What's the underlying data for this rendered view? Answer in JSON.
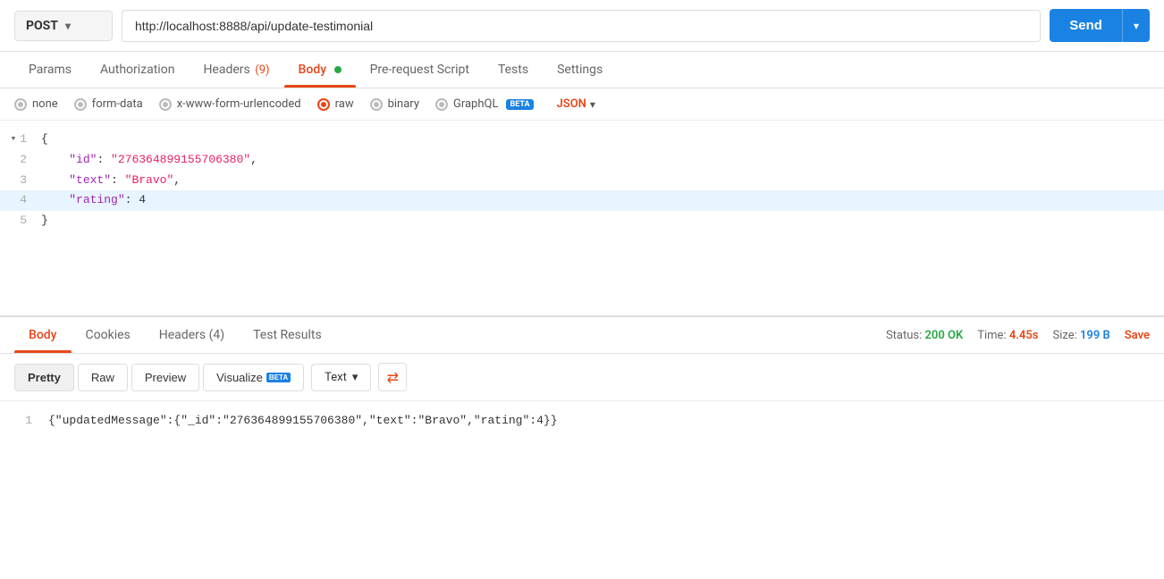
{
  "method": "POST",
  "url": "http://localhost:8888/api/update-testimonial",
  "send_label": "Send",
  "tabs": [
    {
      "label": "Params",
      "active": false,
      "badge": null
    },
    {
      "label": "Authorization",
      "active": false,
      "badge": null
    },
    {
      "label": "Headers",
      "active": false,
      "badge": "(9)"
    },
    {
      "label": "Body",
      "active": true,
      "badge": null,
      "dot": true
    },
    {
      "label": "Pre-request Script",
      "active": false,
      "badge": null
    },
    {
      "label": "Tests",
      "active": false,
      "badge": null
    },
    {
      "label": "Settings",
      "active": false,
      "badge": null
    }
  ],
  "body_options": [
    {
      "label": "none",
      "selected": false
    },
    {
      "label": "form-data",
      "selected": false
    },
    {
      "label": "x-www-form-urlencoded",
      "selected": false
    },
    {
      "label": "raw",
      "selected": true
    },
    {
      "label": "binary",
      "selected": false
    },
    {
      "label": "GraphQL",
      "selected": false,
      "beta": true
    }
  ],
  "json_label": "JSON",
  "code_lines": [
    {
      "num": 1,
      "arrow": "▾",
      "content": "{",
      "type": "brace"
    },
    {
      "num": 2,
      "content": "    \"id\": \"276364899155706380\",",
      "key": "id",
      "val_str": "276364899155706380"
    },
    {
      "num": 3,
      "content": "    \"text\": \"Bravo\",",
      "key": "text",
      "val_str": "Bravo"
    },
    {
      "num": 4,
      "content": "    \"rating\": 4",
      "key": "rating",
      "val_num": "4",
      "highlighted": true
    },
    {
      "num": 5,
      "content": "}",
      "type": "brace"
    }
  ],
  "response_tabs": [
    {
      "label": "Body",
      "active": true
    },
    {
      "label": "Cookies",
      "active": false
    },
    {
      "label": "Headers",
      "active": false,
      "badge": "(4)"
    },
    {
      "label": "Test Results",
      "active": false
    }
  ],
  "status_label": "Status:",
  "status_value": "200 OK",
  "time_label": "Time:",
  "time_value": "4.45s",
  "size_label": "Size:",
  "size_value": "199 B",
  "save_label": "Save",
  "view_buttons": [
    {
      "label": "Pretty",
      "active": true
    },
    {
      "label": "Raw",
      "active": false
    },
    {
      "label": "Preview",
      "active": false
    },
    {
      "label": "Visualize",
      "active": false,
      "beta": true
    }
  ],
  "text_type_label": "Text",
  "response_line": "{\"updatedMessage\":{\"_id\":\"276364899155706380\",\"text\":\"Bravo\",\"rating\":4}}"
}
